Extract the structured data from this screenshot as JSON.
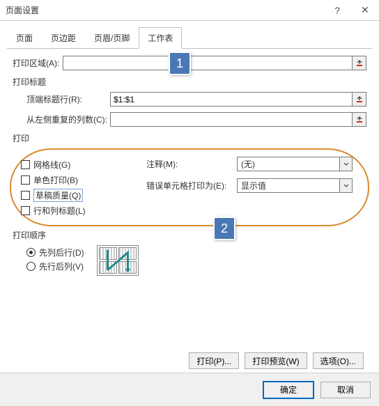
{
  "window": {
    "title": "页面设置"
  },
  "tabs": [
    "页面",
    "页边距",
    "页眉/页脚",
    "工作表"
  ],
  "active_tab_index": 3,
  "callouts": {
    "one": "1",
    "two": "2"
  },
  "print_area": {
    "label": "打印区域(A):",
    "value": ""
  },
  "titles": {
    "section": "打印标题",
    "top_rows_label": "顶端标题行(R):",
    "top_rows_value": "$1:$1",
    "left_cols_label": "从左侧重复的列数(C):",
    "left_cols_value": ""
  },
  "print": {
    "section": "打印",
    "gridlines": "网格线(G)",
    "black_white": "单色打印(B)",
    "draft": "草稿质量(Q)",
    "row_col_head": "行和列标题(L)",
    "comments_label": "注释(M):",
    "comments_value": "(无)",
    "errors_label": "错误单元格打印为(E):",
    "errors_value": "显示值"
  },
  "order": {
    "section": "打印顺序",
    "down_over": "先列后行(D)",
    "over_down": "先行后列(V)"
  },
  "buttons": {
    "print": "打印(P)...",
    "preview": "打印预览(W)",
    "options": "选项(O)...",
    "ok": "确定",
    "cancel": "取消"
  }
}
